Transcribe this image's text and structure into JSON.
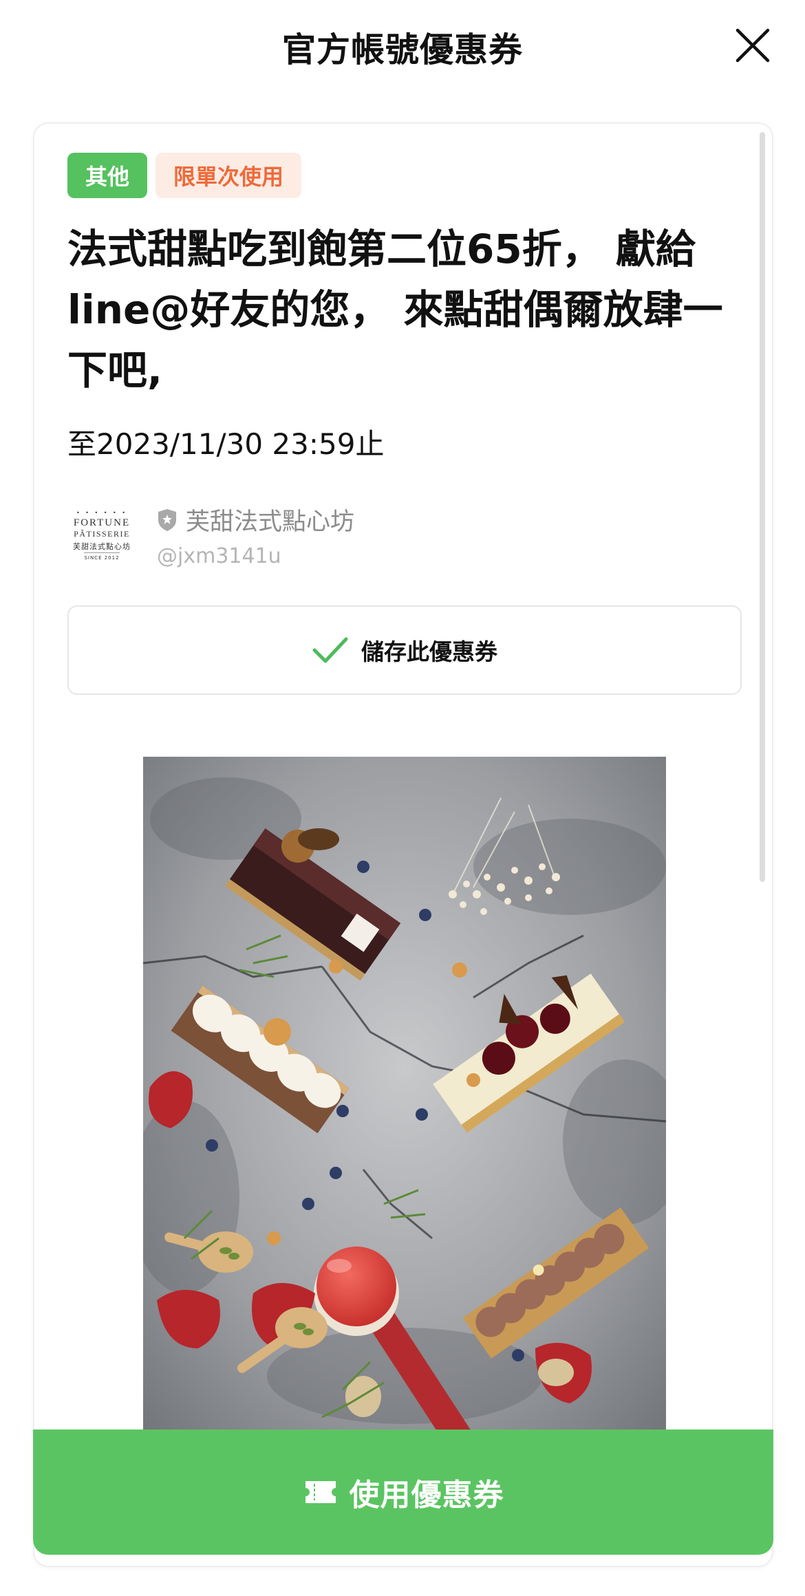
{
  "header": {
    "title": "官方帳號優惠券"
  },
  "coupon": {
    "tags": {
      "category": "其他",
      "limit": "限單次使用"
    },
    "title": "法式甜點吃到飽第二位65折， 獻給line@好友的您， 來點甜偶爾放肆一下吧,",
    "expiry": "至2023/11/30 23:59止"
  },
  "account": {
    "logo_text": {
      "line1": "FORTUNE",
      "line2": "PÂTISSERIE",
      "line3": "芙甜法式點心坊",
      "line4": "SINCE 2012"
    },
    "name": "芙甜法式點心坊",
    "id": "@jxm3141u"
  },
  "actions": {
    "save_label": "儲存此優惠券",
    "use_label": "使用優惠券"
  },
  "icons": {
    "close": "close-icon",
    "verified": "shield-star-icon",
    "save": "checkmark-icon",
    "use": "ticket-icon"
  },
  "colors": {
    "brand_green": "#5bc462",
    "tag_category_bg": "#55c15f",
    "tag_limit_bg": "#fdece4",
    "tag_limit_text": "#ee6a3a",
    "muted_text": "#8c8c8c"
  }
}
